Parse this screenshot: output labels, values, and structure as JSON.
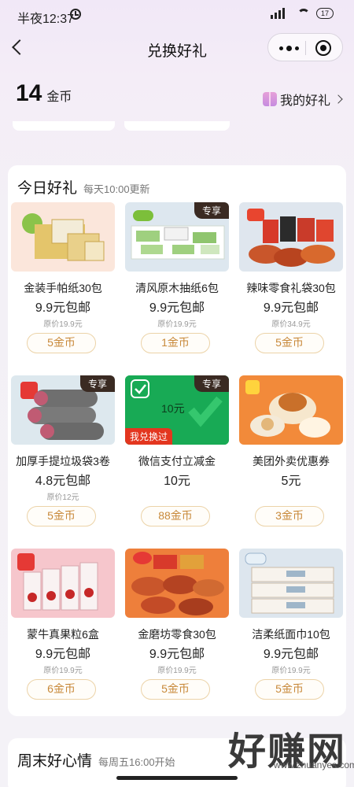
{
  "status": {
    "time": "半夜12:37",
    "battery": "17"
  },
  "nav": {
    "title": "兑换好礼"
  },
  "header": {
    "coins": "14",
    "coin_unit": "金币",
    "my_gift": "我的好礼"
  },
  "today": {
    "title": "今日好礼",
    "subtitle": "每天10:00更新",
    "items": [
      {
        "name": "金装手帕纸30包",
        "price": "9.9元包邮",
        "original": "原价19.9元",
        "cost": "5金币",
        "tag": ""
      },
      {
        "name": "清风原木抽纸6包",
        "price": "9.9元包邮",
        "original": "原价19.9元",
        "cost": "1金币",
        "tag": "专享"
      },
      {
        "name": "辣味零食礼袋30包",
        "price": "9.9元包邮",
        "original": "原价34.9元",
        "cost": "5金币",
        "tag": ""
      },
      {
        "name": "加厚手提垃圾袋3卷",
        "price": "4.8元包邮",
        "original": "原价12元",
        "cost": "5金币",
        "tag": "专享"
      },
      {
        "name": "微信支付立减金",
        "price": "10元",
        "original": "",
        "cost": "88金币",
        "tag": "专享",
        "img_text": "10元",
        "badge": "我兑换过"
      },
      {
        "name": "美团外卖优惠券",
        "price": "5元",
        "original": "",
        "cost": "3金币",
        "tag": ""
      },
      {
        "name": "蒙牛真果粒6盒",
        "price": "9.9元包邮",
        "original": "原价19.9元",
        "cost": "6金币",
        "tag": ""
      },
      {
        "name": "金磨坊零食30包",
        "price": "9.9元包邮",
        "original": "原价19.9元",
        "cost": "5金币",
        "tag": ""
      },
      {
        "name": "洁柔纸面巾10包",
        "price": "9.9元包邮",
        "original": "原价19.9元",
        "cost": "5金币",
        "tag": ""
      }
    ]
  },
  "weekend": {
    "title": "周末好心情",
    "subtitle": "每周五16:00开始"
  },
  "watermark": {
    "text": "好赚网",
    "url": "www.zhuanyes.com"
  }
}
